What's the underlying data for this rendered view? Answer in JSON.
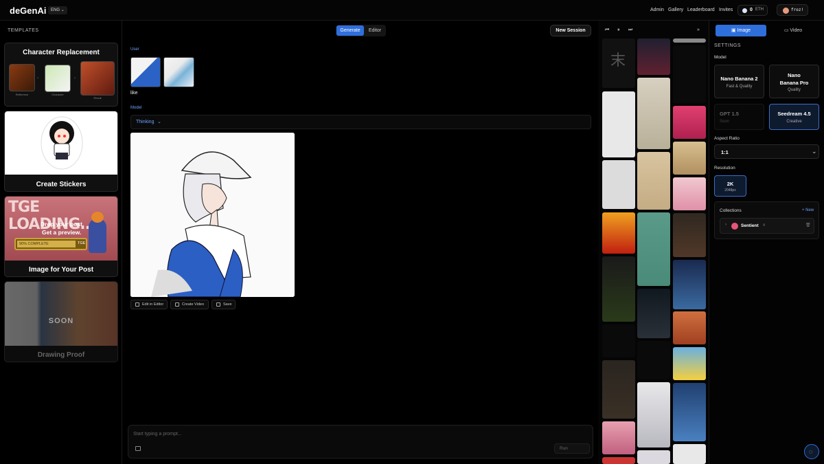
{
  "header": {
    "logo": "deGenAi",
    "lang": "ENG",
    "nav": [
      "Admin",
      "Gallery",
      "Leaderboard",
      "Invites"
    ],
    "balance": "0",
    "currency": "ETH",
    "username": "froz!"
  },
  "templates": {
    "title": "TEMPLATES",
    "cards": [
      {
        "title": "Character Replacement",
        "captions": [
          "Reference",
          "Character",
          "Result"
        ]
      },
      {
        "title": "Create Stickers"
      },
      {
        "title": "Image for Your Post",
        "banner": "TGE LOADING...",
        "line1": "Drop your post.",
        "line2": "Get a preview.",
        "progress": "90% COMPLETE",
        "tge": "TGE"
      },
      {
        "title": "Drawing Proof",
        "badge": "SOON"
      }
    ]
  },
  "center": {
    "tabs": [
      "Generate",
      "Editor"
    ],
    "active_tab": "Generate",
    "new_session": "New Session",
    "user_label": "User",
    "user_text": "like",
    "model_label": "Model",
    "model_mode": "Thinking",
    "actions": [
      "Edit in Editor",
      "Create Video",
      "Save"
    ],
    "prompt_placeholder": "Start typing a prompt...",
    "run": "Run"
  },
  "right": {
    "tabs": [
      "Image",
      "Video"
    ],
    "settings": "SETTINGS",
    "model_label": "Model",
    "models": [
      {
        "name": "Nano Banana 2",
        "sub": "Fast & Quality"
      },
      {
        "name": "Nano Banana Pro",
        "sub": "Quality"
      },
      {
        "name": "GPT 1.5",
        "sub": "Soon"
      },
      {
        "name": "Seedream 4.5",
        "sub": "Creative"
      }
    ],
    "selected_model": "Seedream 4.5",
    "aspect_label": "Aspect Ratio",
    "aspect_value": "1:1",
    "resolution_label": "Resolution",
    "resolution": {
      "value": "2K",
      "sub": "2048px"
    },
    "collections_label": "Collections",
    "new_label": "+ New",
    "collection": {
      "name": "Sentient",
      "count": "4"
    }
  },
  "colors": {
    "accent": "#2f6fdc",
    "panel": "#0d0d0d",
    "border": "#2a2a2a"
  }
}
